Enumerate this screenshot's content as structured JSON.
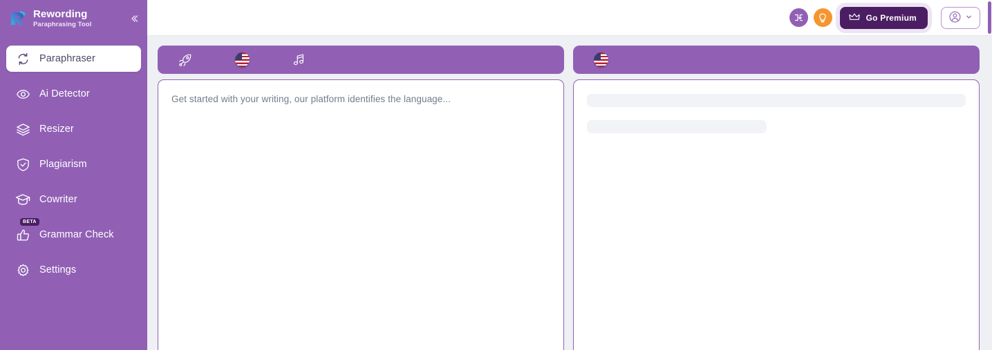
{
  "brand": {
    "title": "Rewording",
    "subtitle": "Paraphrasing Tool",
    "logo_icon": "rewording-r-logo",
    "collapse_icon": "chevron-double-left-icon"
  },
  "sidebar": {
    "background_color": "#9160b5",
    "items": [
      {
        "label": "Paraphraser",
        "icon": "refresh-cycle-icon",
        "active": true,
        "badge": ""
      },
      {
        "label": "Ai Detector",
        "icon": "eye-icon",
        "active": false,
        "badge": ""
      },
      {
        "label": "Resizer",
        "icon": "layers-icon",
        "active": false,
        "badge": ""
      },
      {
        "label": "Plagiarism",
        "icon": "shield-check-icon",
        "active": false,
        "badge": ""
      },
      {
        "label": "Cowriter",
        "icon": "graduation-cap-icon",
        "active": false,
        "badge": ""
      },
      {
        "label": "Grammar Check",
        "icon": "thumbs-up-icon",
        "active": false,
        "badge": "BETA"
      },
      {
        "label": "Settings",
        "icon": "gear-icon",
        "active": false,
        "badge": ""
      }
    ]
  },
  "topbar": {
    "import_button": {
      "icon": "download-import-icon",
      "color": "#9160b5"
    },
    "tips_button": {
      "icon": "lightbulb-icon",
      "color": "#f5952f"
    },
    "premium_button": {
      "label": "Go Premium",
      "icon": "crown-icon",
      "color": "#4b1d63"
    },
    "account_button": {
      "icon": "user-avatar-icon",
      "chevron": "chevron-down-icon"
    }
  },
  "workspace": {
    "input_panel": {
      "toolbar": {
        "modes_icon": "rocket-icon",
        "language_icon": "us-flag-icon",
        "tone_icon": "music-note-icon"
      },
      "editor_placeholder": "Get started with your writing, our platform identifies the language..."
    },
    "output_panel": {
      "toolbar": {
        "language_icon": "us-flag-icon"
      },
      "skeleton_lines": 2
    }
  },
  "scrollbar": {
    "name": "page-scrollbar",
    "thumb_color": "#9160b5"
  },
  "colors": {
    "brand_purple": "#9160b5",
    "deep_purple": "#4b1d63",
    "accent_orange": "#f5952f",
    "page_background": "#eef0f4"
  }
}
